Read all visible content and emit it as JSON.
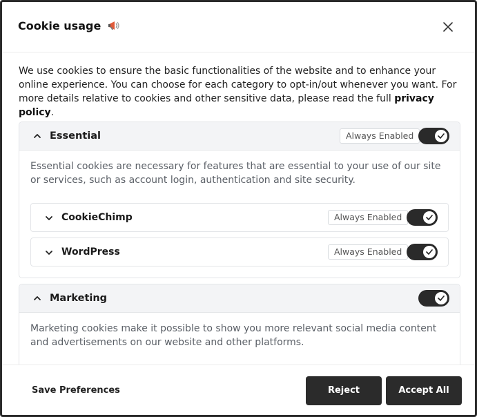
{
  "modal": {
    "title": "Cookie usage",
    "title_icon": "megaphone-icon",
    "close_icon": "close-icon"
  },
  "intro": {
    "text": "We use cookies to ensure the basic functionalities of the website and to enhance your online experience. You can choose for each category to opt-in/out whenever you want. For more details relative to cookies and other sensitive data, please read the full ",
    "link_text": "privacy policy",
    "suffix": "."
  },
  "categories": [
    {
      "title": "Essential",
      "badge": "Always Enabled",
      "enabled": true,
      "expanded": true,
      "description": "Essential cookies are necessary for features that are essential to your use of our site or services, such as account login, authentication and site security.",
      "services": [
        {
          "title": "CookieChimp",
          "badge": "Always Enabled",
          "enabled": true
        },
        {
          "title": "WordPress",
          "badge": "Always Enabled",
          "enabled": true
        }
      ]
    },
    {
      "title": "Marketing",
      "enabled": true,
      "expanded": true,
      "description": "Marketing cookies make it possible to show you more relevant social media content and advertisements on our website and other platforms."
    }
  ],
  "footer": {
    "save_label": "Save Preferences",
    "reject_label": "Reject",
    "accept_label": "Accept All"
  },
  "colors": {
    "accent_dark": "#2b2b2b",
    "header_bg": "#f3f4f6",
    "border": "#e3e5e8"
  }
}
